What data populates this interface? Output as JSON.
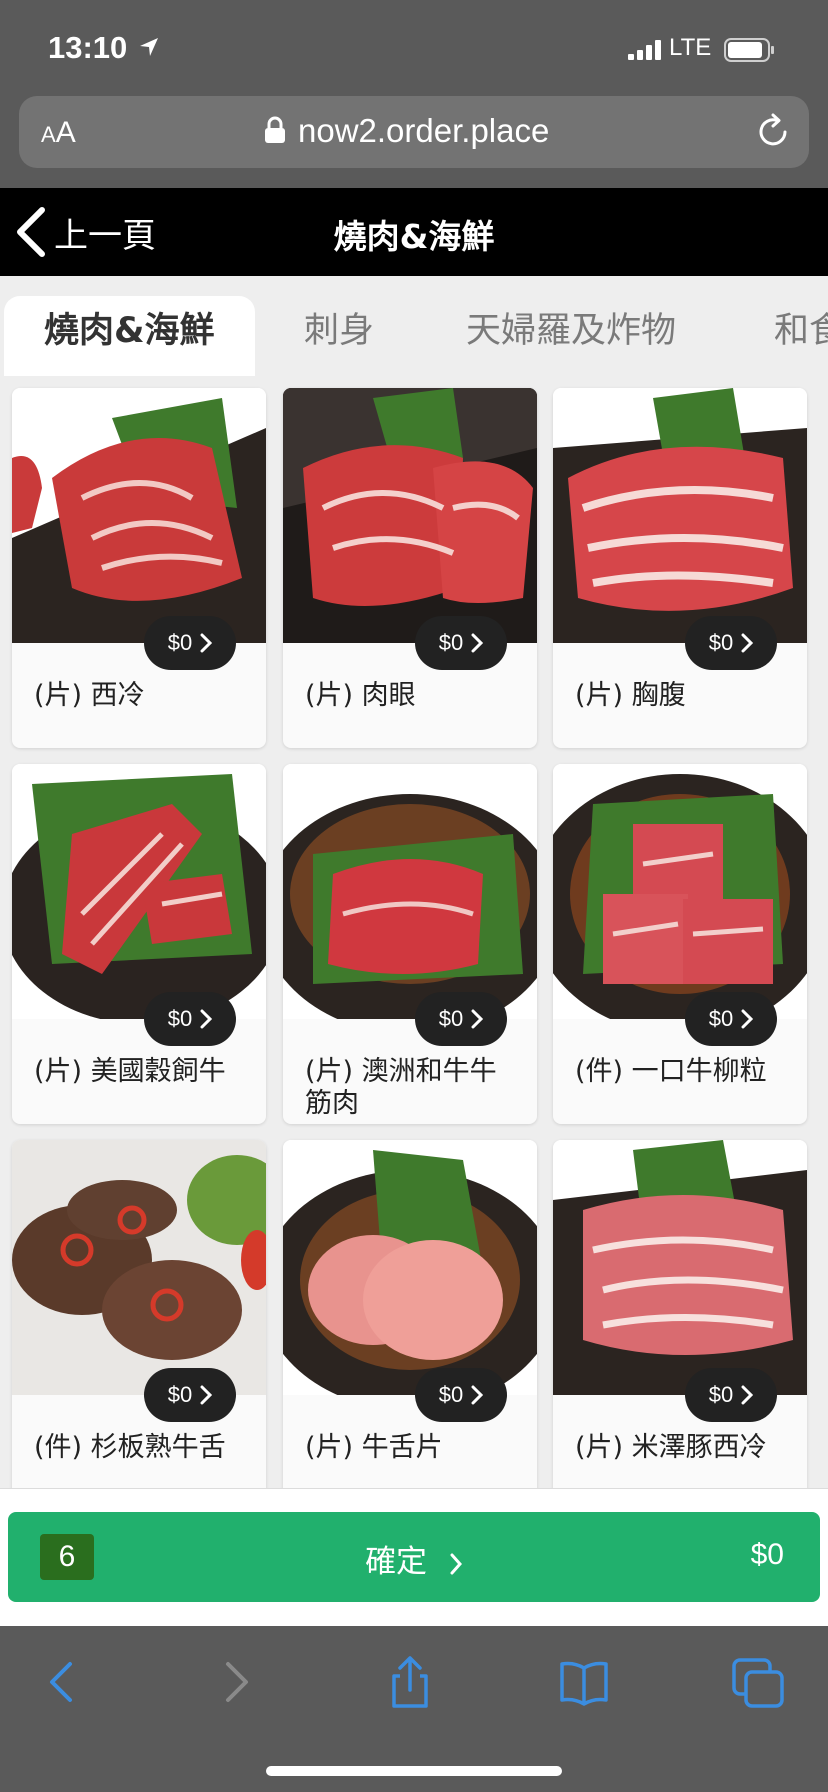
{
  "status_bar": {
    "time": "13:10",
    "network": "LTE"
  },
  "browser": {
    "text_size_label_small": "A",
    "text_size_label_large": "A",
    "url": "now2.order.place"
  },
  "header": {
    "back_label": "上一頁",
    "title": "燒肉&海鮮"
  },
  "tabs": [
    {
      "label": "燒肉&海鮮",
      "active": true
    },
    {
      "label": "刺身",
      "active": false
    },
    {
      "label": "天婦羅及炸物",
      "active": false
    },
    {
      "label": "和食",
      "active": false
    }
  ],
  "products": [
    {
      "name": "(片) 西冷",
      "price": "$0"
    },
    {
      "name": "(片) 肉眼",
      "price": "$0"
    },
    {
      "name": "(片) 胸腹",
      "price": "$0"
    },
    {
      "name": "(片) 美國穀飼牛",
      "price": "$0"
    },
    {
      "name": "(片) 澳洲和牛牛筋肉",
      "price": "$0"
    },
    {
      "name": "(件) 一口牛柳粒",
      "price": "$0"
    },
    {
      "name": "(件) 杉板熟牛舌",
      "price": "$0"
    },
    {
      "name": "(片) 牛舌片",
      "price": "$0"
    },
    {
      "name": "(片) 米澤豚西冷",
      "price": "$0"
    }
  ],
  "confirm": {
    "count": "6",
    "label": "確定",
    "total": "$0"
  },
  "colors": {
    "accent_green": "#21b06d",
    "badge_green": "#2a6e1e",
    "ios_link_blue": "#3b8de0"
  }
}
